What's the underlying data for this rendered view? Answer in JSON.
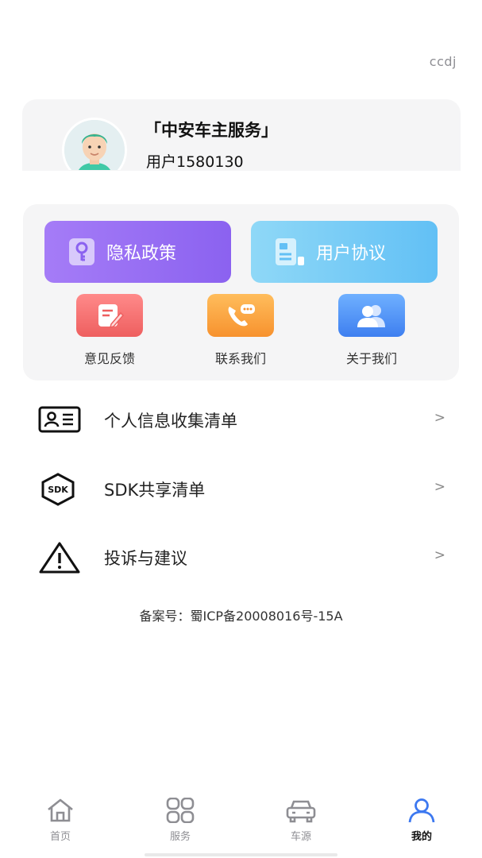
{
  "header": {
    "top_right_text": "ccdj"
  },
  "profile": {
    "app_name": "「中安车主服务」",
    "user_name": "用户1580130"
  },
  "features": {
    "primary": [
      {
        "label": "隐私政策",
        "icon": "key-icon"
      },
      {
        "label": "用户协议",
        "icon": "document-icon"
      }
    ],
    "secondary": [
      {
        "label": "意见反馈",
        "icon": "edit-icon"
      },
      {
        "label": "联系我们",
        "icon": "phone-chat-icon"
      },
      {
        "label": "关于我们",
        "icon": "users-icon"
      }
    ]
  },
  "menu": [
    {
      "label": "个人信息收集清单",
      "icon": "id-card-icon",
      "chevron": ">"
    },
    {
      "label": "SDK共享清单",
      "icon": "sdk-icon",
      "icon_text": "SDK",
      "chevron": ">"
    },
    {
      "label": "投诉与建议",
      "icon": "warning-icon",
      "chevron": ">"
    }
  ],
  "icp": "备案号：蜀ICP备20008016号-15A",
  "tabs": [
    {
      "label": "首页",
      "icon": "home-icon",
      "active": false
    },
    {
      "label": "服务",
      "icon": "grid-icon",
      "active": false
    },
    {
      "label": "车源",
      "icon": "car-icon",
      "active": false
    },
    {
      "label": "我的",
      "icon": "user-icon",
      "active": true
    }
  ],
  "colors": {
    "privacy_button": "#8b62f0",
    "agreement_button": "#62c0f5",
    "feedback_icon": "#f26a6a",
    "contact_icon": "#f7a13d",
    "about_icon": "#4d8ff2",
    "active_tab": "#3c78f0"
  }
}
